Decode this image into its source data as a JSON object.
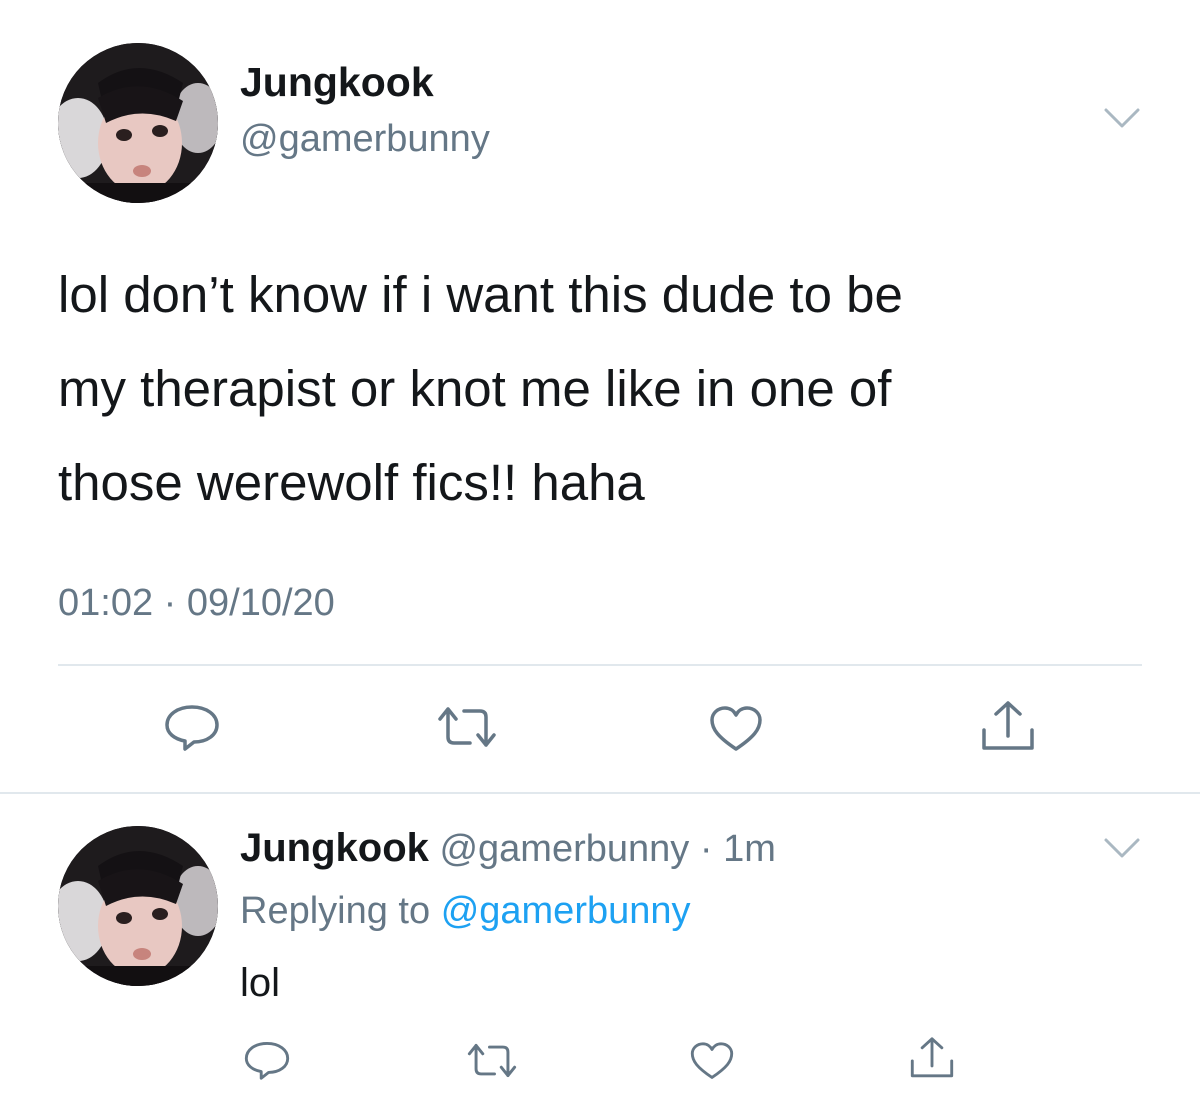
{
  "main_tweet": {
    "display_name": "Jungkook",
    "handle": "@gamerbunny",
    "text_lines": [
      "lol don’t know if i want this dude to be",
      "my therapist or knot me like in one of",
      "those werewolf fics!! haha"
    ],
    "time": "01:02",
    "separator": "·",
    "date": "09/10/20",
    "avatar_icon": "profile-photo",
    "menu_icon": "chevron-down-icon",
    "actions": [
      {
        "name": "reply",
        "icon": "speech-bubble-icon"
      },
      {
        "name": "retweet",
        "icon": "retweet-arrows-icon"
      },
      {
        "name": "like",
        "icon": "heart-icon"
      },
      {
        "name": "share",
        "icon": "share-upload-icon"
      }
    ]
  },
  "reply_tweet": {
    "display_name": "Jungkook",
    "handle": "@gamerbunny",
    "separator": "·",
    "time_ago": "1m",
    "replying_label": "Replying to",
    "replying_to": "@gamerbunny",
    "text": "lol",
    "avatar_icon": "profile-photo",
    "menu_icon": "chevron-down-icon",
    "actions": [
      {
        "name": "reply",
        "icon": "speech-bubble-icon"
      },
      {
        "name": "retweet",
        "icon": "retweet-arrows-icon"
      },
      {
        "name": "like",
        "icon": "heart-icon"
      },
      {
        "name": "share",
        "icon": "share-upload-icon"
      }
    ]
  },
  "colors": {
    "text_primary": "#14171a",
    "text_secondary": "#657786",
    "link": "#1da1f2",
    "divider": "#e1e8ed",
    "icon": "#657786"
  }
}
